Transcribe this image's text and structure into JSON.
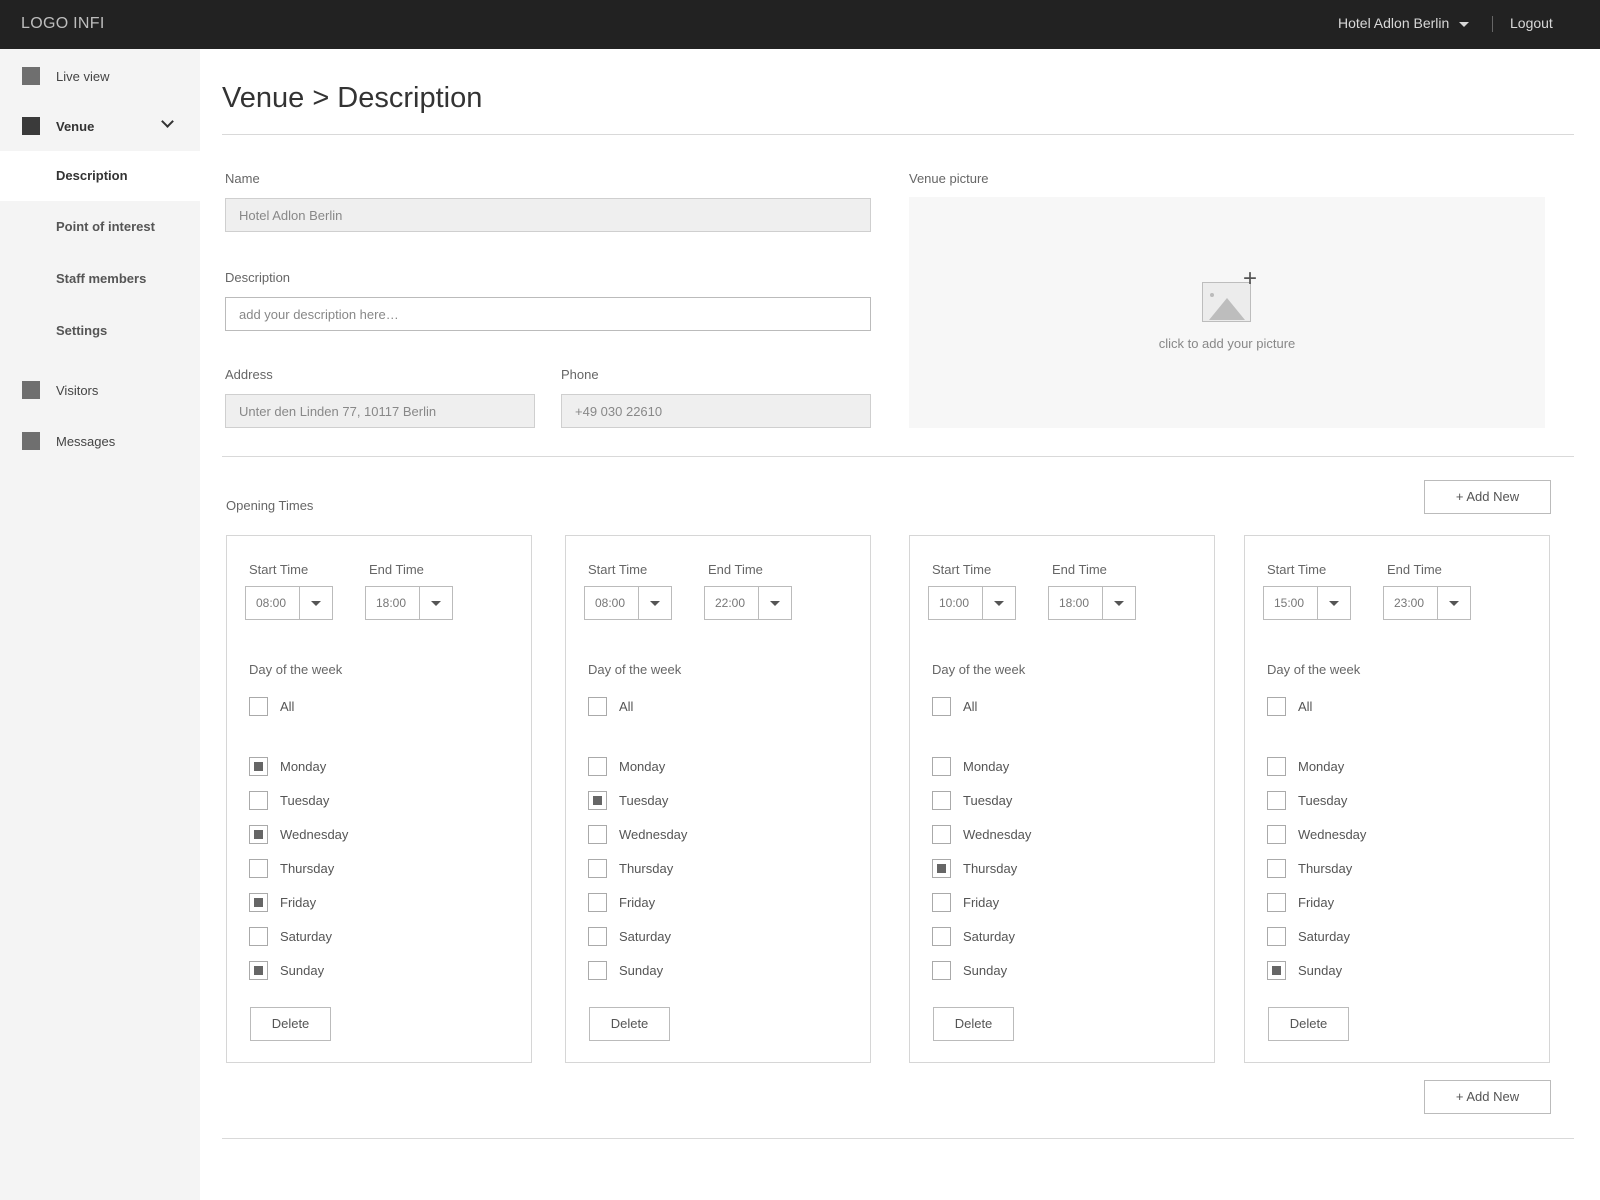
{
  "topbar": {
    "logo": "LOGO INFI",
    "venue_selector": "Hotel Adlon Berlin",
    "logout": "Logout"
  },
  "sidebar": {
    "live_view": "Live view",
    "venue": "Venue",
    "sub": [
      "Description",
      "Point of interest",
      "Staff members",
      "Settings"
    ],
    "visitors": "Visitors",
    "messages": "Messages"
  },
  "page": {
    "title": "Venue > Description"
  },
  "form": {
    "name_label": "Name",
    "name_value": "Hotel Adlon Berlin",
    "description_label": "Description",
    "description_placeholder": "add your description here…",
    "address_label": "Address",
    "address_value": "Unter den Linden 77, 10117 Berlin",
    "phone_label": "Phone",
    "phone_value": "+49 030 22610",
    "picture_label": "Venue picture",
    "picture_caption": "click to add your picture"
  },
  "opening": {
    "label": "Opening Times",
    "add_new": "+ Add New",
    "start_label": "Start Time",
    "end_label": "End Time",
    "dow_label": "Day of the week",
    "all_label": "All",
    "delete_label": "Delete",
    "days": [
      "Monday",
      "Tuesday",
      "Wednesday",
      "Thursday",
      "Friday",
      "Saturday",
      "Sunday"
    ],
    "cards": [
      {
        "start": "08:00",
        "end": "18:00",
        "all": false,
        "checked": [
          true,
          false,
          true,
          false,
          true,
          false,
          true
        ]
      },
      {
        "start": "08:00",
        "end": "22:00",
        "all": false,
        "checked": [
          false,
          true,
          false,
          false,
          false,
          false,
          false
        ]
      },
      {
        "start": "10:00",
        "end": "18:00",
        "all": false,
        "checked": [
          false,
          false,
          false,
          true,
          false,
          false,
          false
        ]
      },
      {
        "start": "15:00",
        "end": "23:00",
        "all": false,
        "checked": [
          false,
          false,
          false,
          false,
          false,
          false,
          true
        ]
      }
    ]
  }
}
